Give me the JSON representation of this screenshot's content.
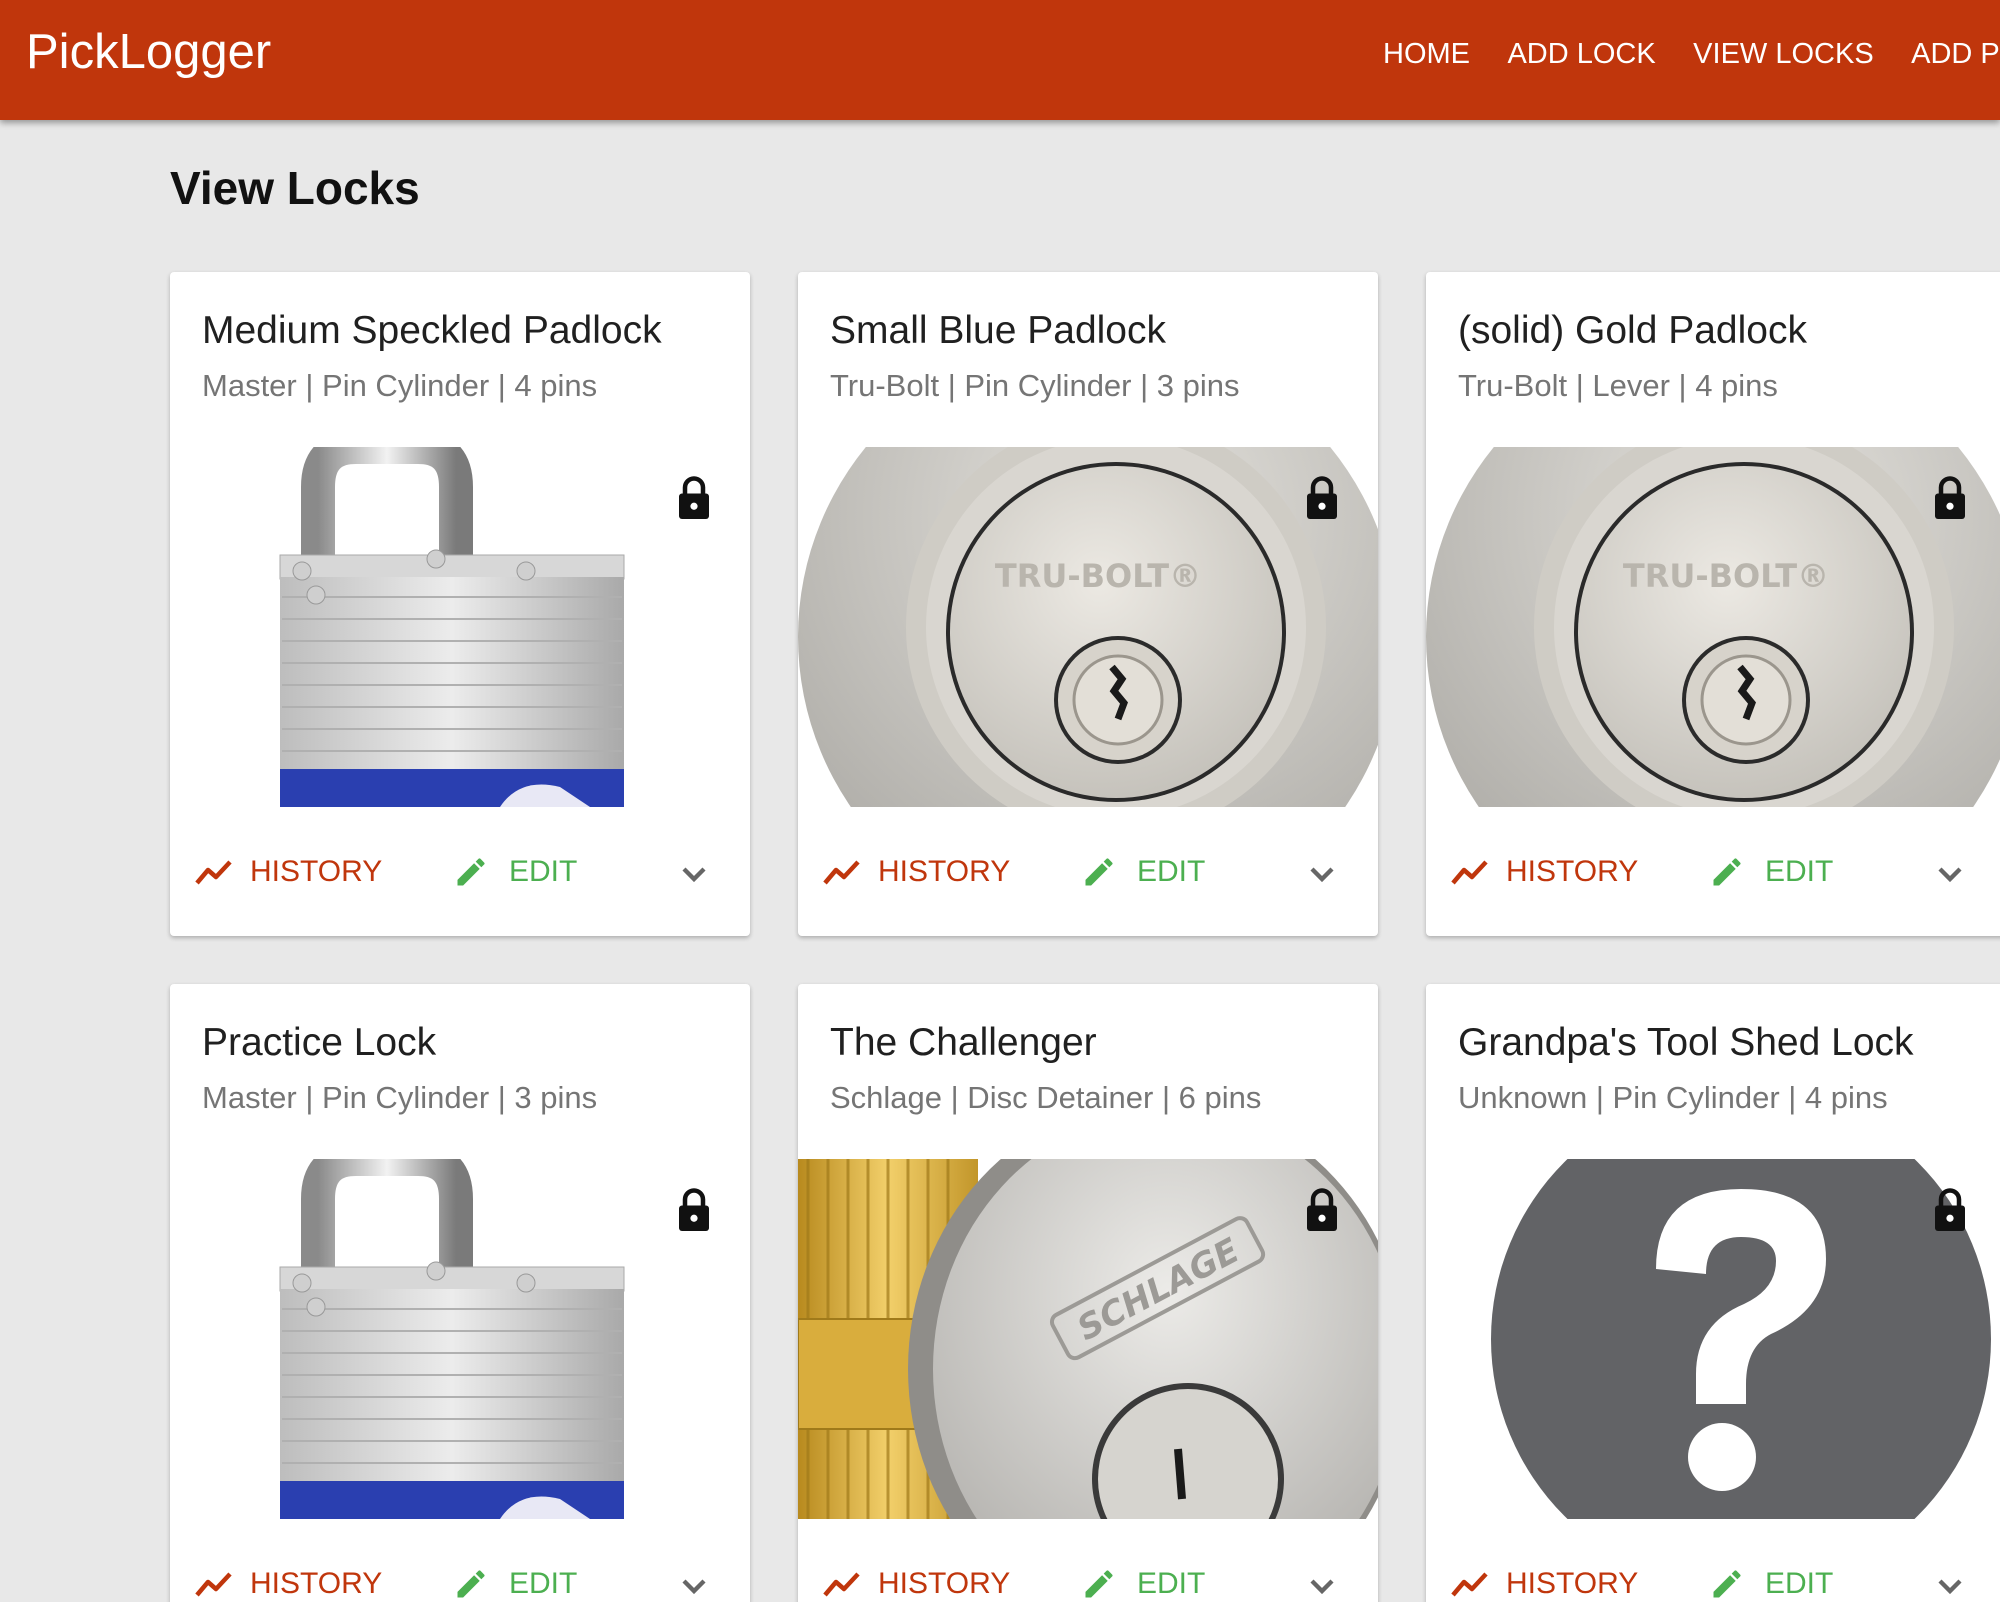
{
  "app": {
    "name": "PickLogger"
  },
  "nav": {
    "home": "HOME",
    "add_lock": "ADD LOCK",
    "view_locks": "VIEW LOCKS",
    "add_pick": "ADD PI"
  },
  "page": {
    "title": "View Locks"
  },
  "actions": {
    "history": "HISTORY",
    "edit": "EDIT"
  },
  "colors": {
    "appbar": "#c0360c",
    "history": "#c0360c",
    "edit": "#4caf50",
    "background": "#e8e8e8"
  },
  "icons": {
    "history": "trending-up-icon",
    "edit": "pencil-icon",
    "expand": "chevron-down-icon",
    "locked": "lock-icon"
  },
  "cards": [
    {
      "title": "Medium Speckled Padlock",
      "subtitle": "Master | Pin Cylinder | 4 pins",
      "image": "padlock"
    },
    {
      "title": "Small Blue Padlock",
      "subtitle": "Tru-Bolt | Pin Cylinder | 3 pins",
      "image": "deadbolt",
      "brand_mark": "TRU-BOLT®"
    },
    {
      "title": "(solid) Gold Padlock",
      "subtitle": "Tru-Bolt | Lever | 4 pins",
      "image": "deadbolt",
      "brand_mark": "TRU-BOLT®"
    },
    {
      "title": "Practice Lock",
      "subtitle": "Master | Pin Cylinder | 3 pins",
      "image": "padlock"
    },
    {
      "title": "The Challenger",
      "subtitle": "Schlage | Disc Detainer | 6 pins",
      "image": "cylinder",
      "brand_mark": "SCHLAGE"
    },
    {
      "title": "Grandpa's Tool Shed Lock",
      "subtitle": "Unknown | Pin Cylinder | 4 pins",
      "image": "unknown"
    }
  ]
}
